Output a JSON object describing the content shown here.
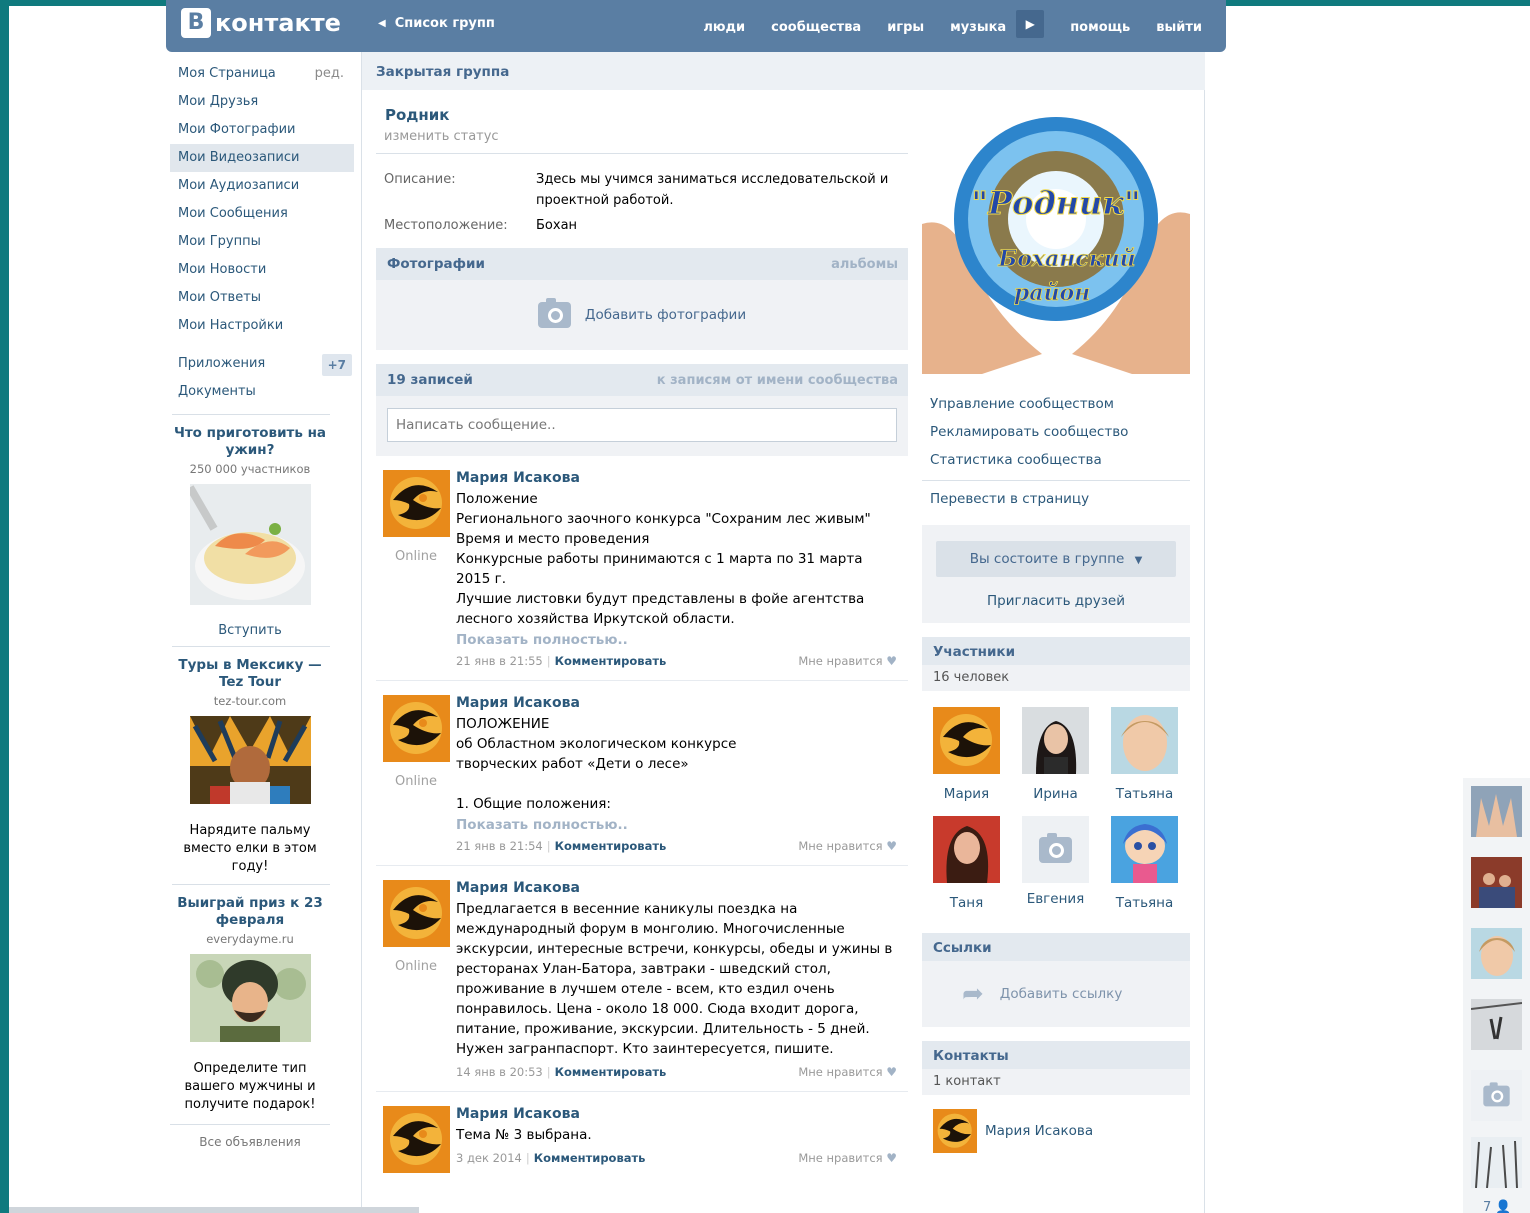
{
  "header": {
    "logo_letter": "В",
    "logo_text": "контакте",
    "back_label": "Список групп",
    "nav": [
      "люди",
      "сообщества",
      "игры",
      "музыка",
      "помощь",
      "выйти"
    ]
  },
  "sidebar": {
    "items": [
      {
        "label": "Моя Страница",
        "extra": "ред."
      },
      {
        "label": "Мои Друзья"
      },
      {
        "label": "Мои Фотографии"
      },
      {
        "label": "Мои Видеозаписи"
      },
      {
        "label": "Мои Аудиозаписи"
      },
      {
        "label": "Мои Сообщения"
      },
      {
        "label": "Мои Группы"
      },
      {
        "label": "Мои Новости"
      },
      {
        "label": "Мои Ответы"
      },
      {
        "label": "Мои Настройки"
      }
    ],
    "apps_label": "Приложения",
    "apps_badge": "+7",
    "docs_label": "Документы",
    "ads": [
      {
        "title": "Что приготовить на ужин?",
        "domain": "250 000 участников",
        "action": "Вступить"
      },
      {
        "title": "Туры в Мексику — Tez Tour",
        "domain": "tez-tour.com",
        "text": "Нарядите пальму вместо елки в этом году!"
      },
      {
        "title": "Выиграй приз к 23 февраля",
        "domain": "everydayme.ru",
        "text": "Определите тип вашего мужчины и получите подарок!"
      }
    ],
    "all_ads": "Все объявления"
  },
  "group": {
    "type": "Закрытая группа",
    "name": "Родник",
    "status_link": "изменить статус",
    "description_label": "Описание:",
    "description": "Здесь мы учимся заниматься исследовательской и проектной работой.",
    "location_label": "Местоположение:",
    "location": "Бохан",
    "logo_text": [
      "\"Родник\"",
      "Боханский",
      "район"
    ]
  },
  "photos": {
    "title": "Фотографии",
    "albums": "альбомы",
    "add": "Добавить фотографии"
  },
  "wall": {
    "count": "19 записей",
    "filter": "к записям от имени сообщества",
    "placeholder": "Написать сообщение.."
  },
  "posts": [
    {
      "author": "Мария Исакова",
      "online": "Online",
      "text": "Положение\nРегионального заочного конкурса \"Сохраним лес живым\"\nВремя и место проведения\nКонкурсные работы принимаются с 1 марта по 31 марта 2015 г.\nЛучшие листовки будут представлены в фойе агентства лесного хозяйства Иркутской области.",
      "more": "Показать полностью..",
      "date": "21 янв в 21:55",
      "comment": "Комментировать",
      "like": "Мне нравится"
    },
    {
      "author": "Мария Исакова",
      "online": "Online",
      "text": "ПОЛОЖЕНИЕ\nоб Областном экологическом конкурсе\nтворческих работ «Дети о лесе»\n\n1. Общие положения:",
      "more": "Показать полностью..",
      "date": "21 янв в 21:54",
      "comment": "Комментировать",
      "like": "Мне нравится"
    },
    {
      "author": "Мария Исакова",
      "online": "Online",
      "text": "Предлагается в весенние каникулы поездка на международный форум в монголию. Многочисленные экскурсии, интересные встречи, конкурсы, обеды и ужины в ресторанах Улан-Батора, завтраки - шведский стол, проживание в лучшем отеле - всем, кто ездил очень понравилось. Цена - около 18 000. Сюда входит дорога, питание, проживание, экскурсии. Длительность - 5 дней. Нужен загранпаспорт. Кто заинтересуется, пишите.",
      "date": "14 янв в 20:53",
      "comment": "Комментировать",
      "like": "Мне нравится"
    },
    {
      "author": "Мария Исакова",
      "text": "Тема № 3 выбрана.",
      "date": "3 дек 2014",
      "comment": "Комментировать",
      "like": "Мне нравится"
    }
  ],
  "right": {
    "links": [
      "Управление сообществом",
      "Рекламировать сообщество",
      "Статистика сообщества"
    ],
    "convert": "Перевести в страницу",
    "member_btn": "Вы состоите в группе",
    "invite": "Пригласить друзей",
    "members_title": "Участники",
    "members_count": "16 человек",
    "members": [
      "Мария",
      "Ирина",
      "Татьяна",
      "Таня",
      "Евгения",
      "Татьяна"
    ],
    "links_title": "Ссылки",
    "add_link": "Добавить ссылку",
    "contacts_title": "Контакты",
    "contacts_count": "1 контакт",
    "contact_name": "Мария Исакова"
  },
  "strip": {
    "counter": "7"
  },
  "colors": {
    "header": "#5a7ea3",
    "link": "#2b587a",
    "frame": "#0f7a7e"
  }
}
